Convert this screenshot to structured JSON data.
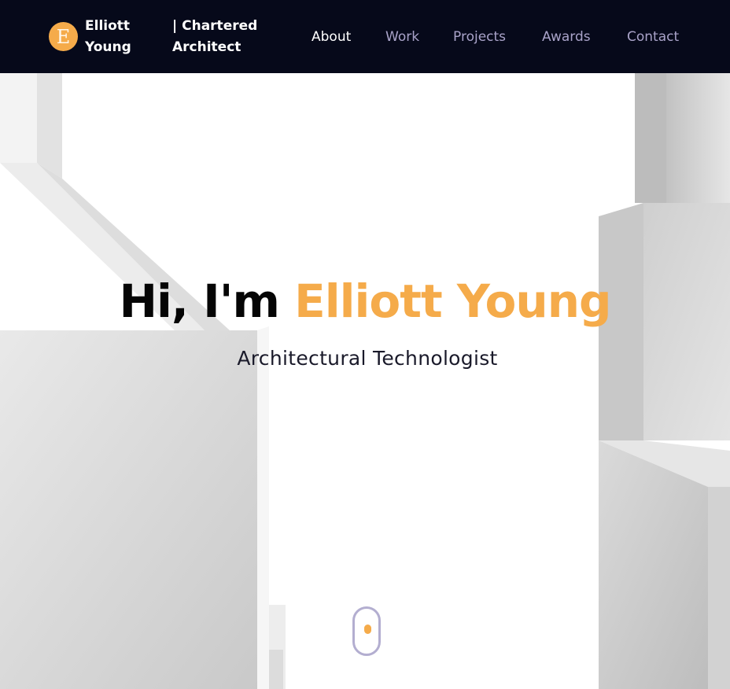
{
  "brand": {
    "initial": "E",
    "name_line1": "Elliott",
    "name_line2": "Young",
    "title_line1": "| Chartered",
    "title_line2": "Architect"
  },
  "nav": {
    "items": [
      {
        "label": "About",
        "active": true
      },
      {
        "label": "Work",
        "active": false
      },
      {
        "label": "Projects",
        "active": false
      },
      {
        "label": "Awards",
        "active": false
      },
      {
        "label": "Contact",
        "active": false
      }
    ]
  },
  "hero": {
    "greeting": "Hi, I'm",
    "name": "Elliott Young",
    "subtitle": "Architectural Technologist"
  },
  "colors": {
    "navbar": "#06091a",
    "accent": "#f5ab4a",
    "nav_inactive": "#a9a3c9",
    "nav_active": "#ffffff",
    "heading_dark": "#050505"
  },
  "icons": {
    "scroll_indicator": "mouse-scroll-icon"
  }
}
